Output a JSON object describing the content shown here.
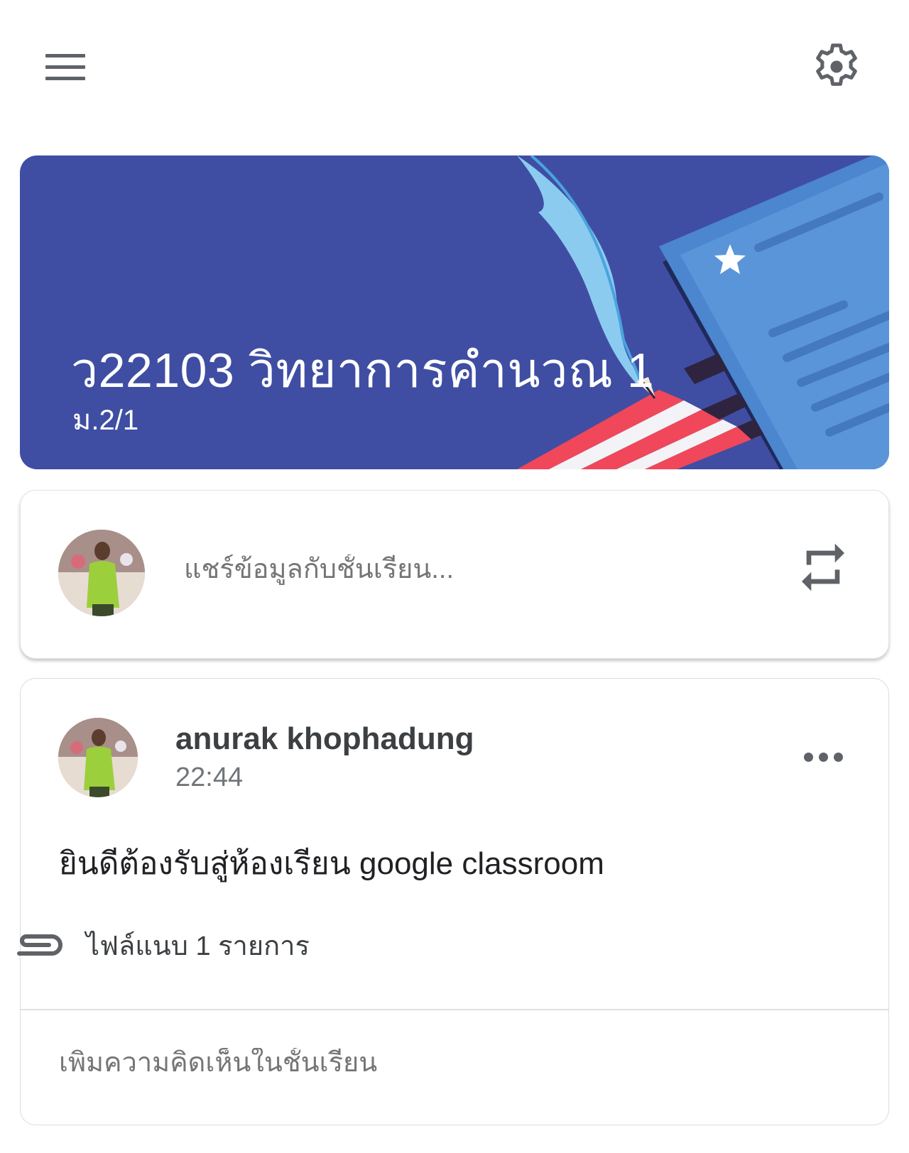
{
  "header": {
    "menu_icon": "hamburger-menu-icon",
    "settings_icon": "gear-icon"
  },
  "banner": {
    "title": "ว22103 วิทยาการคำนวณ 1",
    "section": "ม.2/1",
    "theme_color": "#3f4ea3"
  },
  "share": {
    "placeholder": "แชร์ข้อมูลกับชั้นเรียน...",
    "repost_icon": "repeat-icon"
  },
  "post": {
    "author": "anurak khophadung",
    "time": "22:44",
    "body": "ยินดีต้องรับสู่ห้องเรียน google classroom",
    "attachments_label": "ไฟล์แนบ 1 รายการ",
    "attachment_icon": "paperclip-icon",
    "comment_placeholder": "เพิ่มความคิดเห็นในชั้นเรียน"
  }
}
